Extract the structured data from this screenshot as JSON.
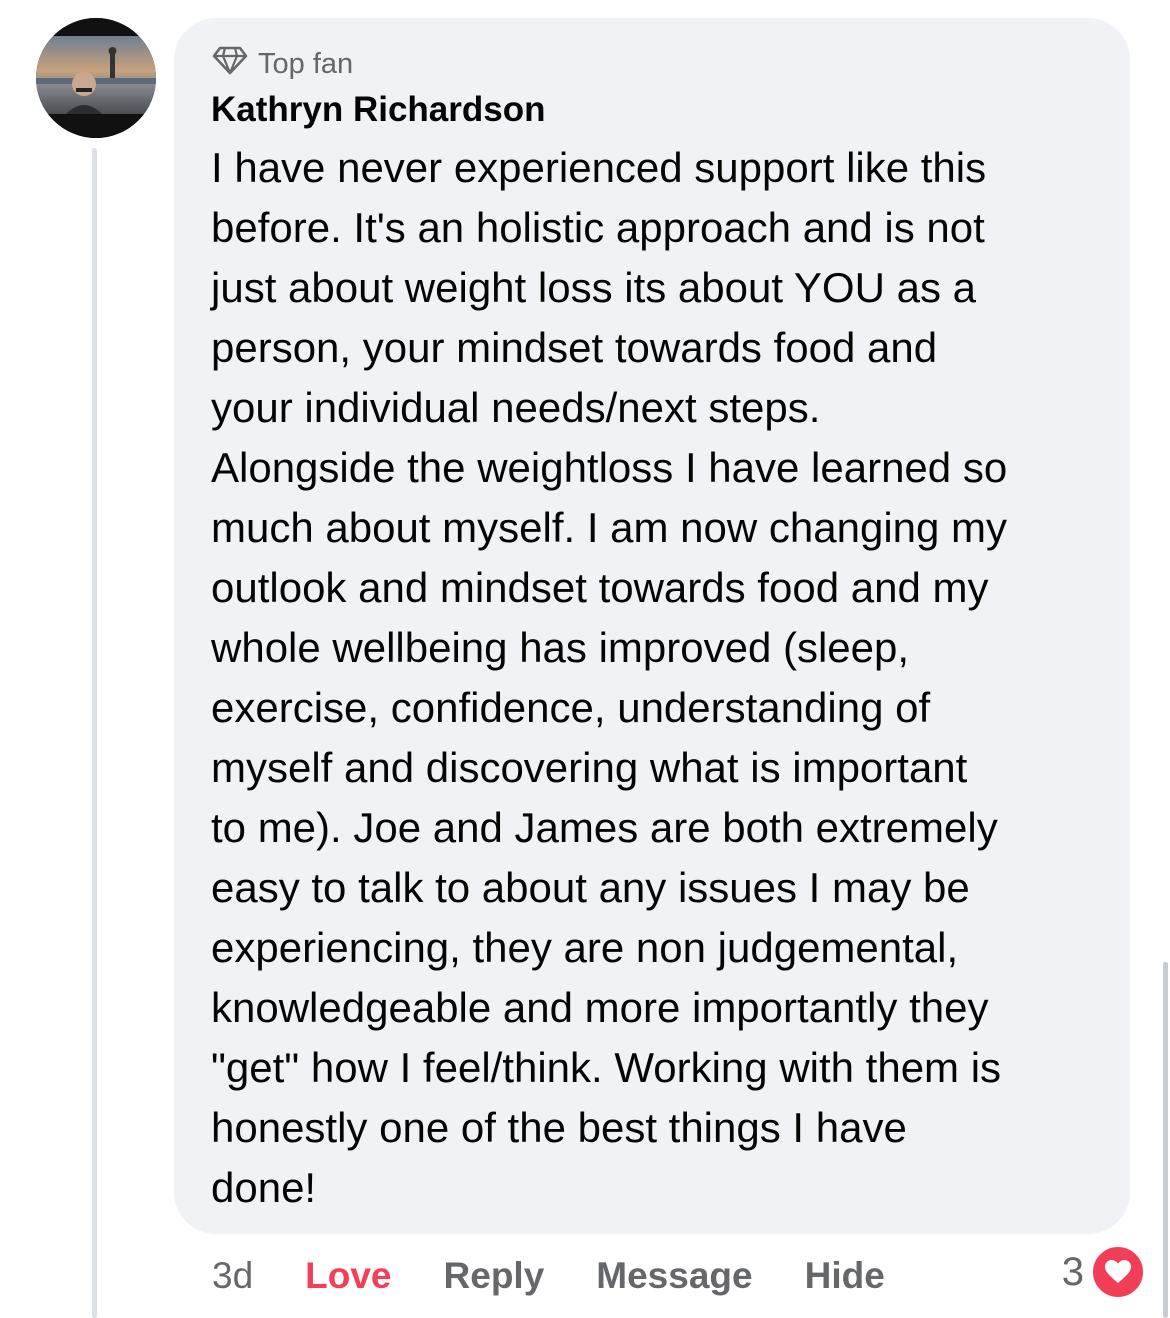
{
  "comment": {
    "badge_label": "Top fan",
    "author": "Kathryn Richardson",
    "text": "I have never experienced support like this\nbefore. It's an holistic approach and is not\njust about weight loss its about YOU as a\nperson, your mindset towards food  and\nyour individual needs/next steps.\nAlongside the weightloss I have learned so\nmuch about myself. I am now changing my\noutlook and mindset towards food and my\nwhole wellbeing has improved (sleep,\nexercise, confidence, understanding of\nmyself and discovering what is important\nto me). Joe and James are both extremely\neasy to talk to about any issues I may be\nexperiencing, they are non judgemental,\nknowledgeable and more importantly they\n\"get\" how I feel/think. Working with them is\nhonestly one of the best things I have\ndone!",
    "timestamp": "3d",
    "reaction_count": "3"
  },
  "actions": {
    "love": "Love",
    "reply": "Reply",
    "message": "Message",
    "hide": "Hide"
  },
  "icons": {
    "badge": "diamond-icon",
    "reaction": "heart-icon"
  },
  "colors": {
    "bubble": "#f0f2f5",
    "love": "#f33e58",
    "muted": "#65676b"
  }
}
